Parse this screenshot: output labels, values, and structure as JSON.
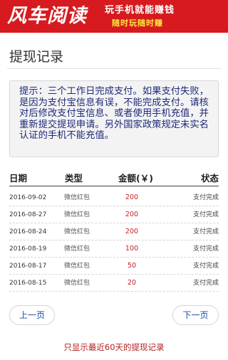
{
  "banner": {
    "brand": "风车阅读",
    "slogan_line1": "玩手机就能赚钱",
    "slogan_line2": "随时玩随时赚"
  },
  "page": {
    "title": "提现记录"
  },
  "notice": {
    "text": "提示：三个工作日完成支付。如果支付失败，是因为支付宝信息有误，不能完成支付。请核对后修改支付宝信息、或者使用手机充值，并重新提交提现申请。另外国家政策规定未实名认证的手机不能充值。"
  },
  "table": {
    "headers": {
      "date": "日期",
      "type": "类型",
      "amount": "金额(￥)",
      "status": "状态"
    },
    "rows": [
      {
        "date": "2016-09-02",
        "type": "微信红包",
        "amount": "200",
        "status": "支付完成"
      },
      {
        "date": "2016-08-27",
        "type": "微信红包",
        "amount": "200",
        "status": "支付完成"
      },
      {
        "date": "2016-08-24",
        "type": "微信红包",
        "amount": "200",
        "status": "支付完成"
      },
      {
        "date": "2016-08-19",
        "type": "微信红包",
        "amount": "100",
        "status": "支付完成"
      },
      {
        "date": "2016-08-17",
        "type": "微信红包",
        "amount": "50",
        "status": "支付完成"
      },
      {
        "date": "2016-08-15",
        "type": "微信红包",
        "amount": "20",
        "status": "支付完成"
      }
    ]
  },
  "pager": {
    "prev_label": "上一页",
    "next_label": "下一页"
  },
  "footer": {
    "note": "只显示最近60天的提现记录"
  },
  "colors": {
    "banner_red": "#d61a1f",
    "slogan_yellow": "#ffe93b",
    "notice_text": "#1f2a7a",
    "amount_red": "#c41f1f",
    "link_blue": "#1f4fa3"
  }
}
